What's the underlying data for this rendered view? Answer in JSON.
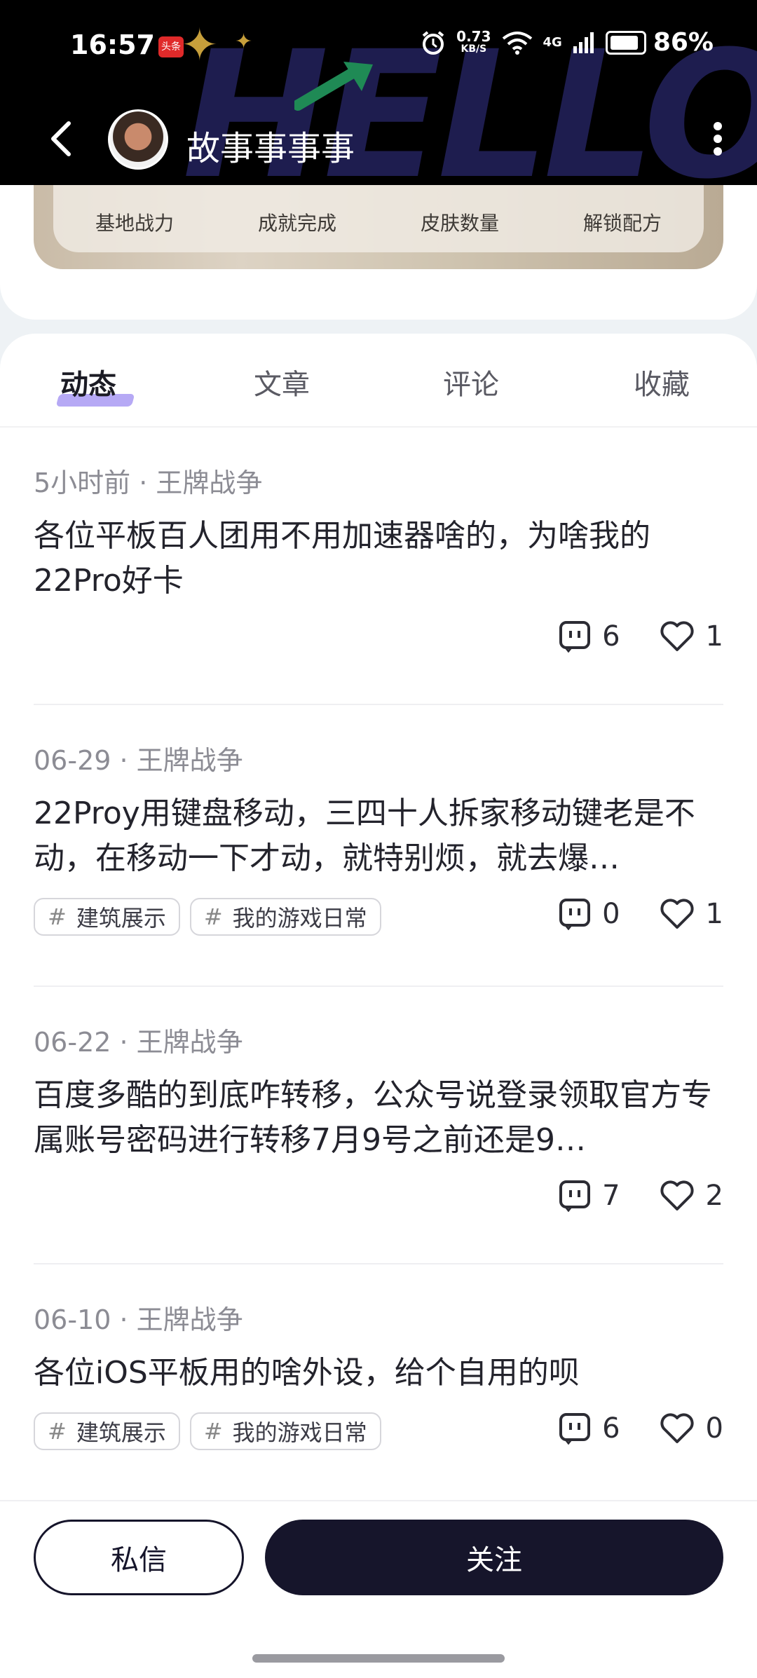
{
  "status_bar": {
    "time": "16:57",
    "app_badge": "头条",
    "net_speed": "0.73",
    "net_unit": "KB/S",
    "net_type": "4G",
    "battery": "86%"
  },
  "header": {
    "banner_text": "HELLO",
    "user_name": "故事事事事"
  },
  "profile_stats": [
    {
      "label": "基地战力"
    },
    {
      "label": "成就完成"
    },
    {
      "label": "皮肤数量"
    },
    {
      "label": "解锁配方"
    }
  ],
  "tabs": [
    {
      "label": "动态",
      "active": true
    },
    {
      "label": "文章",
      "active": false
    },
    {
      "label": "评论",
      "active": false
    },
    {
      "label": "收藏",
      "active": false
    }
  ],
  "posts": [
    {
      "meta": "5小时前 · 王牌战争",
      "title": "各位平板百人团用不用加速器啥的，为啥我的22Pro好卡",
      "tags": [],
      "comments": "6",
      "likes": "1"
    },
    {
      "meta": "06-29 · 王牌战争",
      "title": "22Proy用键盘移动，三四十人拆家移动键老是不动，在移动一下才动，就特别烦，就去爆…",
      "tags": [
        "建筑展示",
        "我的游戏日常"
      ],
      "comments": "0",
      "likes": "1"
    },
    {
      "meta": "06-22 · 王牌战争",
      "title": "百度多酷的到底咋转移，公众号说登录领取官方专属账号密码进行转移7月9号之前还是9…",
      "tags": [],
      "comments": "7",
      "likes": "2"
    },
    {
      "meta": "06-10 · 王牌战争",
      "title": "各位iOS平板用的啥外设，给个自用的呗",
      "tags": [
        "建筑展示",
        "我的游戏日常"
      ],
      "comments": "6",
      "likes": "0"
    }
  ],
  "tag_hash": "#",
  "actions": {
    "message_label": "私信",
    "follow_label": "关注"
  },
  "icons": {
    "back": "back-arrow-icon",
    "more": "more-vertical-icon",
    "comment": "comment-icon",
    "like": "heart-icon"
  }
}
